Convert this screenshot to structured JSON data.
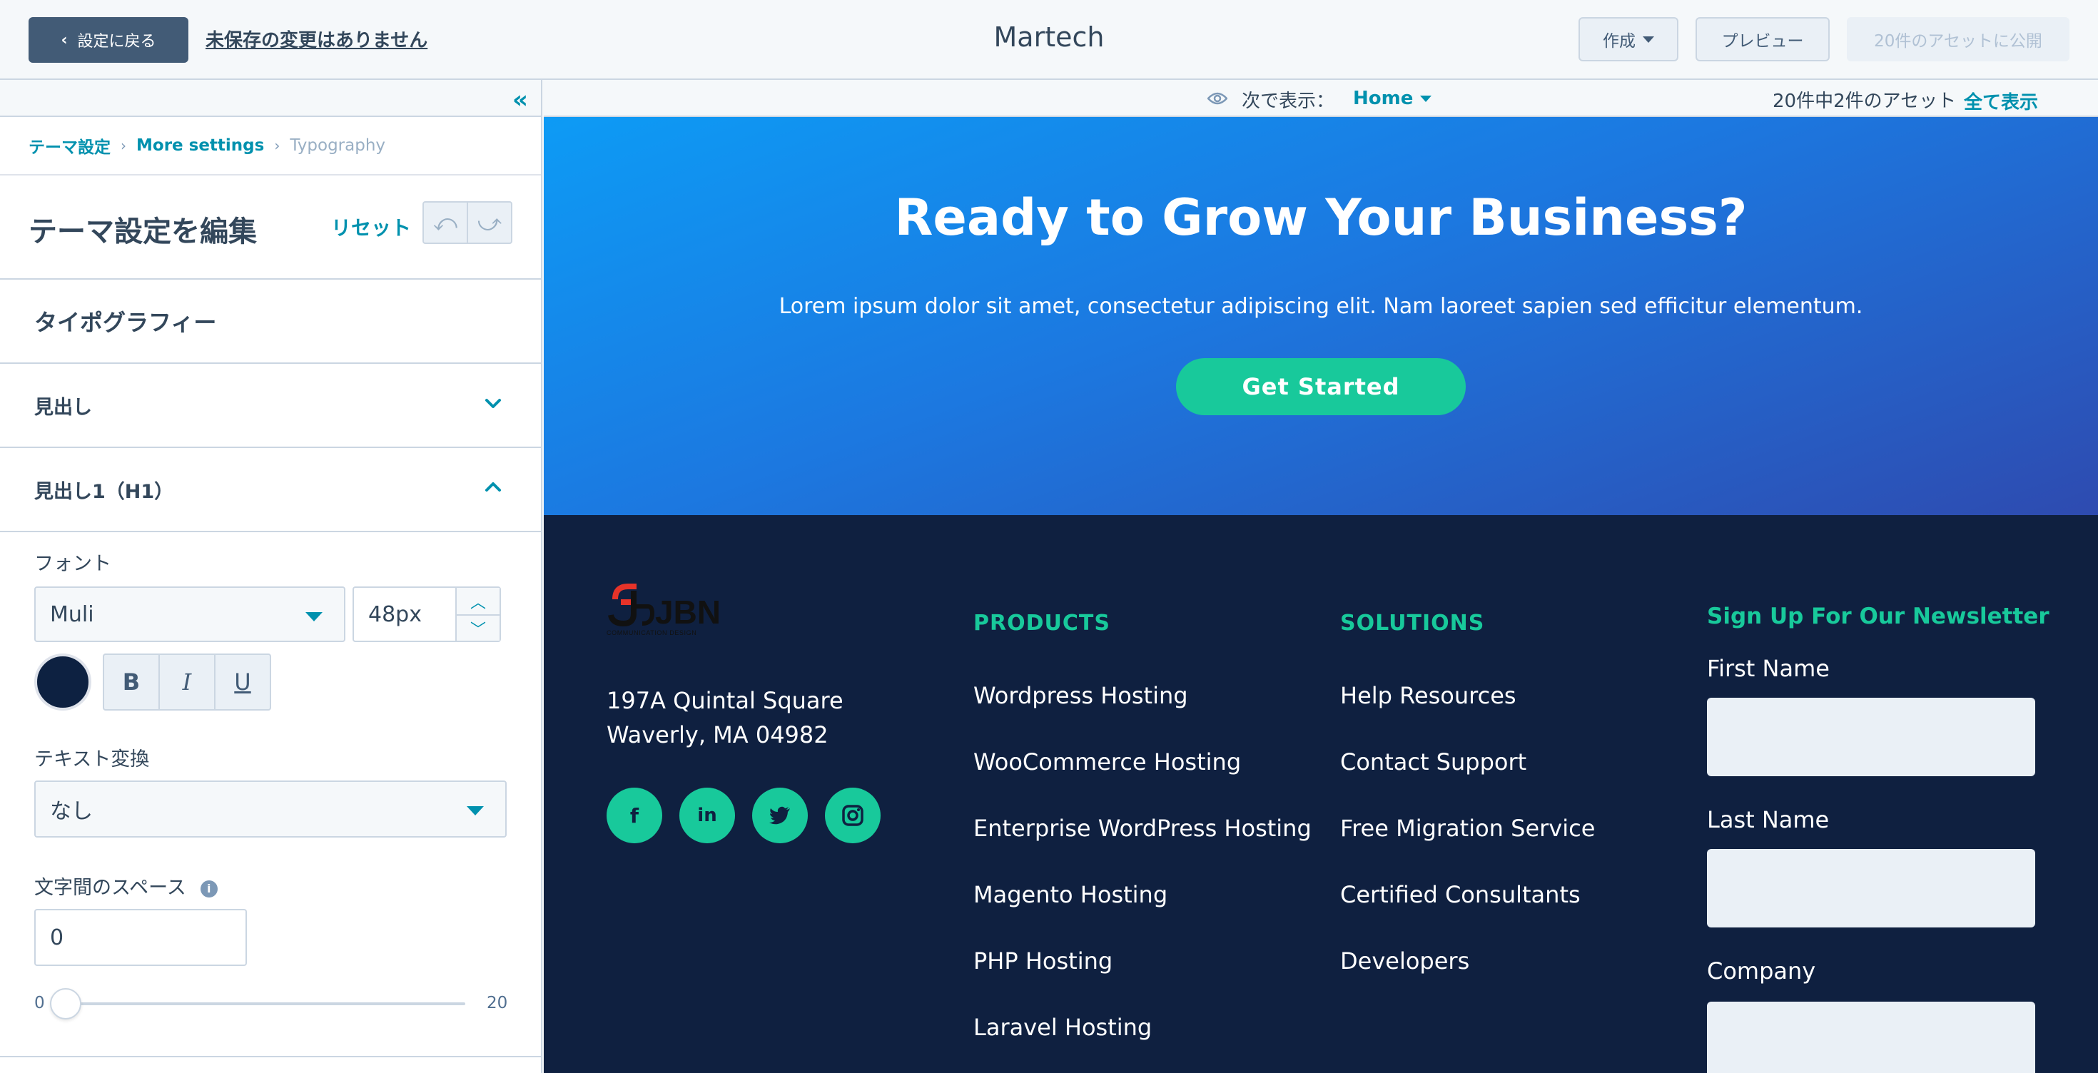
{
  "topbar": {
    "back_label": "設定に戻る",
    "unsaved_text": "未保存の変更はありません",
    "title": "Martech",
    "create_label": "作成",
    "preview_label": "プレビュー",
    "publish_label": "20件のアセットに公開"
  },
  "sidebar": {
    "breadcrumb": [
      "テーマ設定",
      "More settings",
      "Typography"
    ],
    "edit_title": "テーマ設定を編集",
    "reset_label": "リセット",
    "section_title": "タイポグラフィー",
    "accordion_headings": "見出し",
    "accordion_h1": "見出し1（H1）",
    "font_label": "フォント",
    "font_value": "Muli",
    "size_value": "48px",
    "color_value": "#0d2141",
    "bold_glyph": "B",
    "italic_glyph": "I",
    "underline_glyph": "U",
    "transform_label": "テキスト変換",
    "transform_value": "なし",
    "spacing_label": "文字間のスペース",
    "spacing_value": "0",
    "slider_min": "0",
    "slider_max": "20"
  },
  "preview_bar": {
    "view_as_label": "次で表示：",
    "view_as_value": "Home",
    "asset_count": "20件中2件のアセット",
    "show_all": "全て表示"
  },
  "hero": {
    "title": "Ready to Grow Your Business?",
    "subtitle": "Lorem ipsum dolor sit amet, consectetur adipiscing elit. Nam laoreet sapien sed efficitur elementum.",
    "cta": "Get Started"
  },
  "footer": {
    "logo_text": "JBN",
    "logo_tagline": "COMMUNICATION DESIGN",
    "address_line1": "197A Quintal Square",
    "address_line2": "Waverly, MA 04982",
    "socials": [
      "f",
      "in"
    ],
    "products_title": "PRODUCTS",
    "products": [
      "Wordpress Hosting",
      "WooCommerce Hosting",
      "Enterprise WordPress Hosting",
      "Magento Hosting",
      "PHP Hosting",
      "Laravel Hosting"
    ],
    "solutions_title": "SOLUTIONS",
    "solutions": [
      "Help Resources",
      "Contact Support",
      "Free Migration Service",
      "Certified Consultants",
      "Developers"
    ],
    "newsletter_title": "Sign Up For Our Newsletter",
    "first_name_label": "First Name",
    "last_name_label": "Last Name",
    "company_label": "Company"
  },
  "colors": {
    "accent": "#0091ae",
    "brand_green": "#18c99b",
    "footer_bg": "#0f2040"
  }
}
